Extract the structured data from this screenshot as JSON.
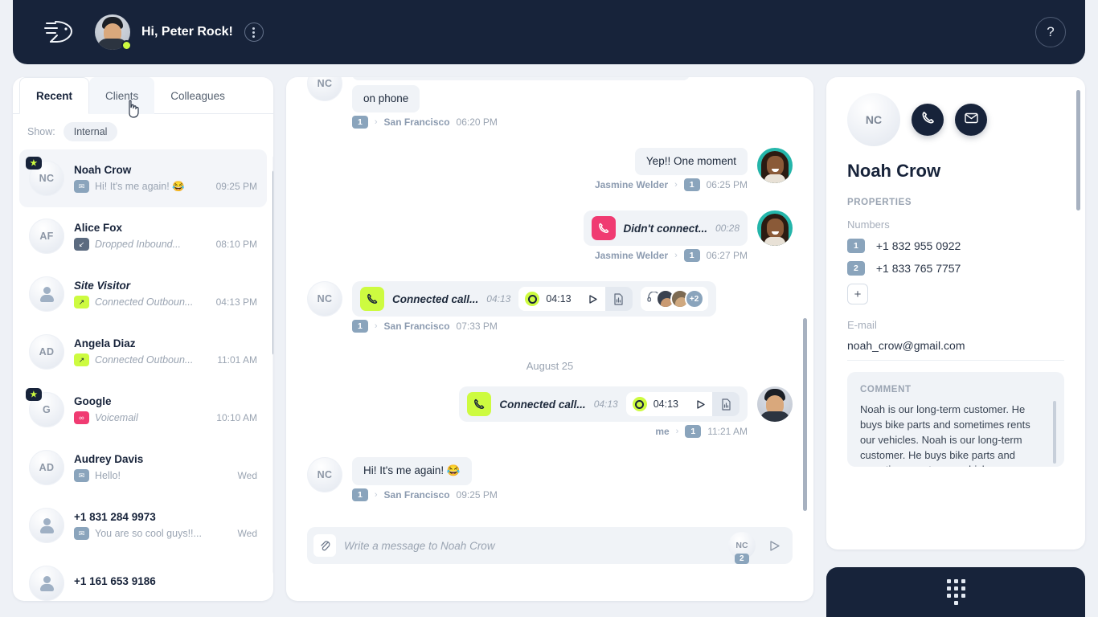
{
  "header": {
    "logo_icon": "brand-logo-icon",
    "greeting": "Hi, Peter Rock!",
    "kebab_icon": "more-options-icon",
    "help_icon": "help-question-icon",
    "status": "online",
    "accent": "#cdfb40",
    "background": "#17233a"
  },
  "sidebar": {
    "tabs": [
      {
        "label": "Recent",
        "active": true
      },
      {
        "label": "Clients",
        "active": false
      },
      {
        "label": "Colleagues",
        "active": false
      }
    ],
    "filter": {
      "label": "Show:",
      "chip": "Internal"
    },
    "contacts": [
      {
        "initials": "NC",
        "name": "Noah Crow",
        "starred": true,
        "selected": true,
        "icon": "sms-icon",
        "icon_type": "sms",
        "preview": "Hi! It's me again! 😂",
        "preview_italic": false,
        "time": "09:25 PM",
        "name_italic": false
      },
      {
        "initials": "AF",
        "name": "Alice Fox",
        "starred": false,
        "selected": false,
        "icon": "inbound-dropped-icon",
        "icon_type": "inb",
        "preview": "Dropped Inbound...",
        "preview_italic": true,
        "time": "08:10 PM",
        "name_italic": false
      },
      {
        "initials": "",
        "name": "Site Visitor",
        "starred": false,
        "selected": false,
        "icon": "outbound-connected-icon",
        "icon_type": "out",
        "preview": "Connected Outboun...",
        "preview_italic": true,
        "time": "04:13 PM",
        "name_italic": true
      },
      {
        "initials": "AD",
        "name": "Angela Diaz",
        "starred": false,
        "selected": false,
        "icon": "outbound-connected-icon",
        "icon_type": "out",
        "preview": "Connected Outboun...",
        "preview_italic": true,
        "time": "11:01 AM",
        "name_italic": false
      },
      {
        "initials": "G",
        "name": "Google",
        "starred": true,
        "selected": false,
        "icon": "voicemail-icon",
        "icon_type": "vm",
        "preview": "Voicemail",
        "preview_italic": true,
        "time": "10:10 AM",
        "name_italic": false
      },
      {
        "initials": "AD",
        "name": "Audrey Davis",
        "starred": false,
        "selected": false,
        "icon": "sms-icon",
        "icon_type": "sms",
        "preview": "Hello!",
        "preview_italic": false,
        "time": "Wed",
        "name_italic": false
      },
      {
        "initials": "",
        "name": "+1 831 284 9973",
        "starred": false,
        "selected": false,
        "icon": "sms-icon",
        "icon_type": "sms",
        "preview": "You are so cool guys!!...",
        "preview_italic": false,
        "time": "Wed",
        "name_italic": false
      },
      {
        "initials": "",
        "name": "+1 161 653 9186",
        "starred": false,
        "selected": false,
        "icon": "sms-icon",
        "icon_type": "sms",
        "preview": "",
        "preview_italic": false,
        "time": "",
        "name_italic": false
      }
    ]
  },
  "chat": {
    "messages": [
      {
        "type": "text",
        "side": "in",
        "initials": "NC",
        "text": "on phone",
        "num": "1",
        "who": "",
        "location": "San Francisco",
        "time": "06:20 PM"
      },
      {
        "type": "text",
        "side": "out",
        "avatar": "woman",
        "text": "Yep!! One moment",
        "num": "1",
        "who": "Jasmine Welder",
        "location": "",
        "time": "06:25 PM"
      },
      {
        "type": "call",
        "side": "out",
        "avatar": "woman",
        "call_label": "Didn't connect...",
        "call_dur": "00:28",
        "call_state": "missed",
        "has_recording": false,
        "num": "1",
        "who": "Jasmine Welder",
        "location": "",
        "time": "06:27 PM"
      },
      {
        "type": "call",
        "side": "in",
        "initials": "NC",
        "call_label": "Connected call...",
        "call_dur": "04:13",
        "call_state": "connected",
        "has_recording": true,
        "rec_time": "04:13",
        "listeners_more": "+2",
        "num": "1",
        "who": "",
        "location": "San Francisco",
        "time": "07:33 PM"
      }
    ],
    "day_separator": "August 25",
    "messages2": [
      {
        "type": "call",
        "side": "out",
        "avatar": "man",
        "call_label": "Connected call...",
        "call_dur": "04:13",
        "call_state": "connected",
        "has_recording": true,
        "rec_time": "04:13",
        "num": "1",
        "who": "me",
        "location": "",
        "time": "11:21 AM"
      },
      {
        "type": "text",
        "side": "in",
        "initials": "NC",
        "text": "Hi! It's me again! 😂",
        "num": "1",
        "who": "",
        "location": "San Francisco",
        "time": "09:25 PM"
      }
    ],
    "composer": {
      "placeholder": "Write a message to Noah Crow",
      "value": "",
      "attach_icon": "paperclip-icon",
      "send_icon": "send-icon",
      "from_initials": "NC",
      "from_number": "2"
    }
  },
  "contact_panel": {
    "initials": "NC",
    "call_icon": "phone-icon",
    "email_icon": "envelope-icon",
    "name": "Noah Crow",
    "properties_title": "PROPERTIES",
    "numbers_label": "Numbers",
    "numbers": [
      {
        "badge": "1",
        "value": "+1 832 955 0922"
      },
      {
        "badge": "2",
        "value": "+1 833 765 7757"
      }
    ],
    "add_number_label": "+",
    "email_label": "E-mail",
    "email_value": "noah_crow@gmail.com",
    "comment_title": "COMMENT",
    "comment_text": "Noah is our long-term customer. He buys bike parts and sometimes rents our vehicles. Noah is our long-term customer. He buys bike parts and sometimes rents our vehicles."
  },
  "dialpad": {
    "icon": "dialpad-icon"
  }
}
